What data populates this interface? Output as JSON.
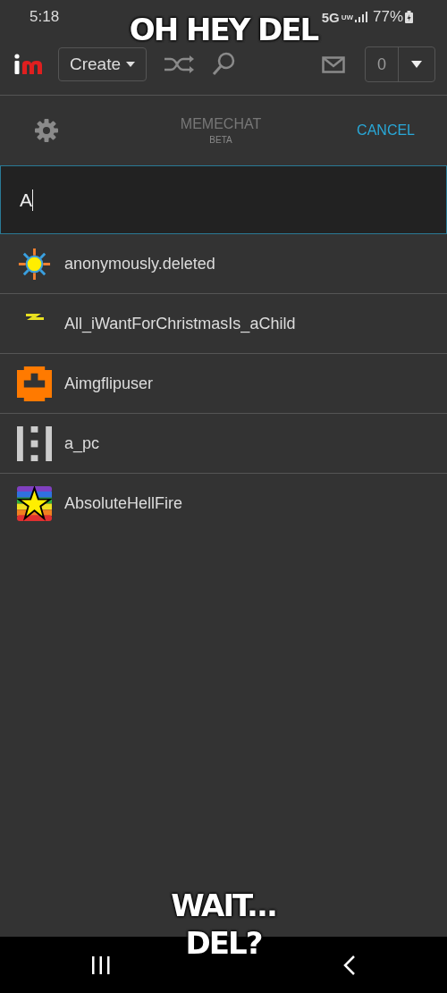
{
  "status_bar": {
    "time": "5:18",
    "network": "5G",
    "network_sub": "UW",
    "battery": "77%"
  },
  "top_nav": {
    "create_label": "Create",
    "notification_count": "0"
  },
  "chat_header": {
    "title": "MEMECHAT",
    "subtitle": "BETA",
    "cancel": "CANCEL"
  },
  "search": {
    "value": "A"
  },
  "users": [
    {
      "name": "anonymously.deleted"
    },
    {
      "name": "All_iWantForChristmasIs_aChild"
    },
    {
      "name": "Aimgflipuser"
    },
    {
      "name": "a_pc"
    },
    {
      "name": "AbsoluteHellFire"
    }
  ],
  "captions": {
    "top": "OH HEY DEL",
    "bottom": [
      "WAIT...",
      "DEL?"
    ]
  }
}
